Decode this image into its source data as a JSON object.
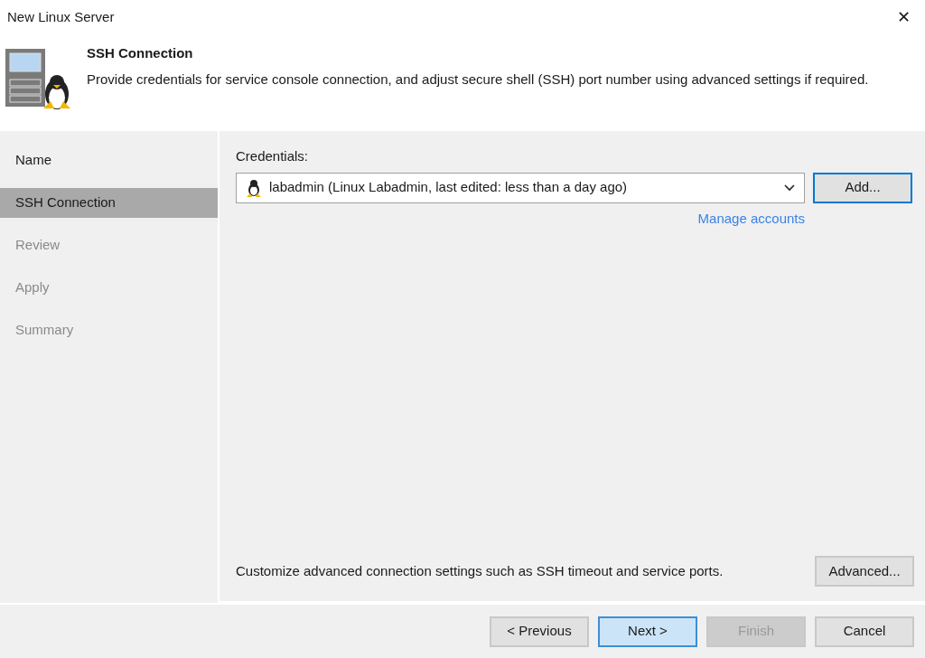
{
  "window": {
    "title": "New Linux Server",
    "close": "✕"
  },
  "header": {
    "title": "SSH Connection",
    "description": "Provide credentials for service console connection, and adjust secure shell (SSH) port number using advanced settings if required."
  },
  "steps": [
    {
      "label": "Name",
      "selected": false,
      "disabled": false
    },
    {
      "label": "SSH Connection",
      "selected": true,
      "disabled": false
    },
    {
      "label": "Review",
      "selected": false,
      "disabled": true
    },
    {
      "label": "Apply",
      "selected": false,
      "disabled": true
    },
    {
      "label": "Summary",
      "selected": false,
      "disabled": true
    }
  ],
  "credentials": {
    "label": "Credentials:",
    "value": "labadmin (Linux Labadmin, last edited: less than a day ago)",
    "add_button": {
      "label": "Add...",
      "focused": true
    },
    "manage_link": "Manage accounts"
  },
  "advanced": {
    "text": "Customize advanced connection settings such as SSH timeout and service ports.",
    "button": "Advanced..."
  },
  "buttons": [
    {
      "label": "< Previous",
      "default": false,
      "disabled": false
    },
    {
      "label": "Next >",
      "default": true,
      "disabled": false
    },
    {
      "label": "Finish",
      "default": false,
      "disabled": true
    },
    {
      "label": "Cancel",
      "default": false,
      "disabled": false
    }
  ]
}
